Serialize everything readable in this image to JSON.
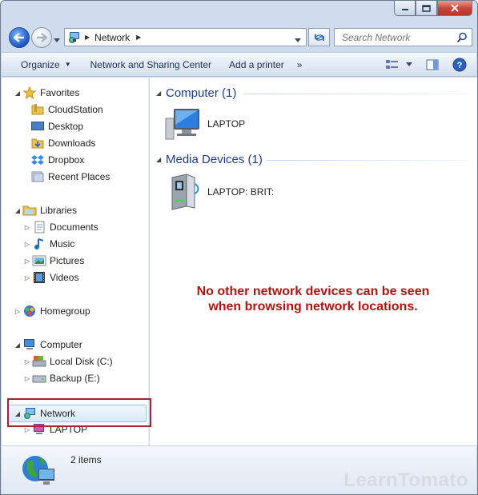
{
  "window": {
    "title_buttons": {
      "minimize": "minimize-icon",
      "maximize": "maximize-icon",
      "close": "close-icon"
    }
  },
  "address": {
    "path": "Network",
    "search_placeholder": "Search Network"
  },
  "toolbar": {
    "organize": "Organize",
    "network_sharing": "Network and Sharing Center",
    "add_printer": "Add a printer",
    "more": "»"
  },
  "nav": {
    "favorites": {
      "label": "Favorites",
      "items": [
        "CloudStation",
        "Desktop",
        "Downloads",
        "Dropbox",
        "Recent Places"
      ]
    },
    "libraries": {
      "label": "Libraries",
      "items": [
        "Documents",
        "Music",
        "Pictures",
        "Videos"
      ]
    },
    "homegroup": "Homegroup",
    "computer": {
      "label": "Computer",
      "items": [
        "Local Disk (C:)",
        "Backup (E:)"
      ]
    },
    "network": {
      "label": "Network",
      "items": [
        "LAPTOP"
      ]
    }
  },
  "main": {
    "groups": [
      {
        "header": "Computer (1)",
        "devices": [
          "LAPTOP"
        ]
      },
      {
        "header": "Media Devices (1)",
        "devices": [
          "LAPTOP: BRIT:"
        ]
      }
    ]
  },
  "annotation": {
    "line1": "No other network devices can be seen",
    "line2": "when browsing network locations."
  },
  "status": {
    "items_count": "2 items"
  },
  "watermark": "LearnTomato",
  "colors": {
    "annotation": "#b01412",
    "highlight_border": "#a4252c",
    "group_header": "#1e3c8c"
  }
}
